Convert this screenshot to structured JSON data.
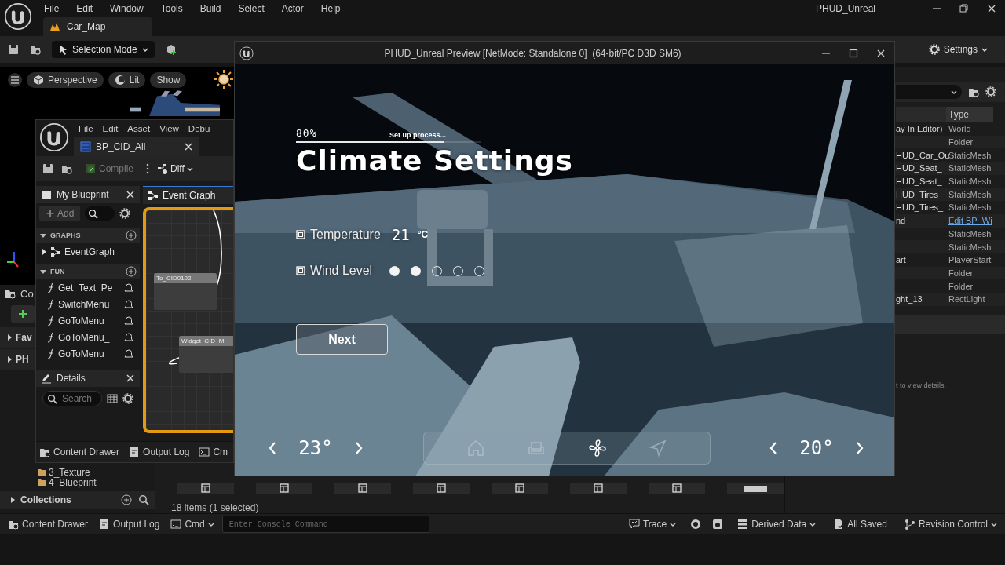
{
  "main_window": {
    "title": "PHUD_Unreal",
    "menu": [
      "File",
      "Edit",
      "Window",
      "Tools",
      "Build",
      "Select",
      "Actor",
      "Help"
    ],
    "tab": "Car_Map",
    "mode_button": "Selection Mode",
    "settings_button": "Settings"
  },
  "viewport": {
    "buttons": [
      "Perspective",
      "Lit",
      "Show"
    ]
  },
  "outliner": {
    "column": "Type",
    "rows": [
      {
        "name": "ay In Editor)",
        "type": "World",
        "kind": "text"
      },
      {
        "type": "Folder",
        "kind": "text"
      },
      {
        "name": "HUD_Car_Ou",
        "type": "StaticMesh",
        "kind": "text"
      },
      {
        "name": "HUD_Seat_",
        "type": "StaticMesh",
        "kind": "text"
      },
      {
        "name": "HUD_Seat_",
        "type": "StaticMesh",
        "kind": "text"
      },
      {
        "name": "HUD_Tires_",
        "type": "StaticMesh",
        "kind": "text"
      },
      {
        "name": "HUD_Tires_",
        "type": "StaticMesh",
        "kind": "text"
      },
      {
        "name": "nd",
        "type": "Edit BP_Wi",
        "kind": "link"
      },
      {
        "type": "StaticMesh",
        "kind": "text"
      },
      {
        "type": "StaticMesh",
        "kind": "text"
      },
      {
        "name": "art",
        "type": "PlayerStart",
        "kind": "text"
      },
      {
        "type": "Folder",
        "kind": "text"
      },
      {
        "type": "Folder",
        "kind": "text"
      },
      {
        "name": "ght_13",
        "type": "RectLight",
        "kind": "text"
      }
    ]
  },
  "details_hint": "t to view details.",
  "content_browser": {
    "tab": "Co",
    "sections": [
      "Fav",
      "PH"
    ],
    "folders": [
      "3_Texture",
      "4  Blueprint"
    ],
    "collections": "Collections",
    "thumbnails": [
      {
        "kind": "blueprint"
      },
      {
        "kind": "blueprint"
      },
      {
        "kind": "blueprint"
      },
      {
        "kind": "blueprint"
      },
      {
        "kind": "blueprint"
      },
      {
        "kind": "blueprint"
      },
      {
        "kind": "blueprint"
      },
      {
        "kind": "widget"
      }
    ],
    "count": "18 items (1 selected)"
  },
  "status_bar": {
    "left": [
      "Content Drawer",
      "Output Log",
      "Cmd"
    ],
    "console_placeholder": "Enter Console Command",
    "trace": "Trace",
    "derived_data": "Derived Data",
    "saved": "All Saved",
    "revision": "Revision Control"
  },
  "blueprint_window": {
    "menu": [
      "File",
      "Edit",
      "Asset",
      "View",
      "Debu"
    ],
    "tab": "BP_CID_All",
    "compile": "Compile",
    "diff": "Diff",
    "my_blueprint": {
      "title": "My Blueprint",
      "add": "Add",
      "sections": [
        {
          "title": "GRAPHS",
          "items": [
            "EventGraph"
          ],
          "kind": "graph"
        },
        {
          "title": "FUN",
          "items": [
            "Get_Text_Pe",
            "SwitchMenu",
            "GoToMenu_",
            "GoToMenu_",
            "GoToMenu_"
          ],
          "kind": "function"
        }
      ]
    },
    "details": {
      "title": "Details",
      "search_placeholder": "Search"
    },
    "graph": {
      "tab": "Event Graph",
      "nodes": [
        "To_CID0102",
        "Widget_CID+M"
      ]
    },
    "status_bar": [
      "Content Drawer",
      "Output Log",
      "Cm"
    ]
  },
  "preview": {
    "title": "PHUD_Unreal Preview [NetMode: Standalone 0]  (64-bit/PC D3D SM6)",
    "progress": {
      "reading": "80%",
      "level": 0.8
    },
    "status": "Set up process...",
    "heading": "Climate Settings",
    "settings": [
      {
        "kind": "value",
        "label": "Temperature",
        "value": "21",
        "unit": "°C"
      },
      {
        "kind": "dots",
        "label": "Wind Level",
        "dots": [
          {
            "on": true
          },
          {
            "on": true
          },
          {
            "on": false
          },
          {
            "on": false
          },
          {
            "on": false
          }
        ]
      }
    ],
    "next": "Next",
    "left_temp": "23°",
    "right_temp": "20°",
    "nav": [
      {
        "kind": "home",
        "selected": false
      },
      {
        "kind": "seat",
        "selected": false
      },
      {
        "kind": "fan",
        "selected": true
      },
      {
        "kind": "navigate",
        "selected": false
      }
    ]
  }
}
